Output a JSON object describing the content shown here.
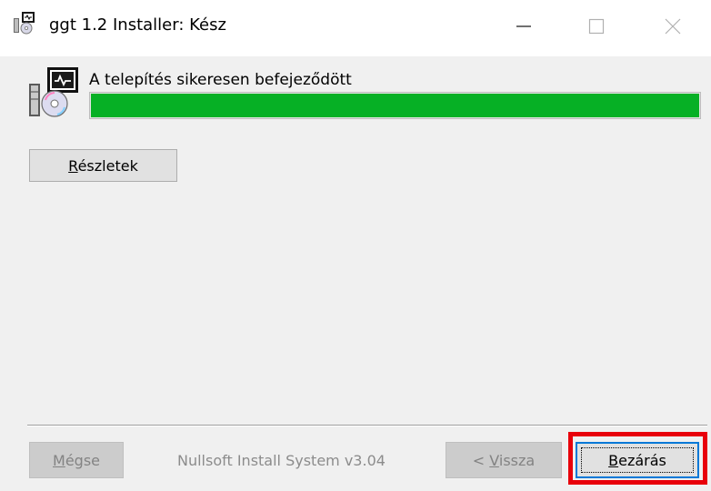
{
  "window": {
    "title": "ggt 1.2 Installer: Kész",
    "icons": {
      "app": "installer-icon",
      "minimize": "minimize-icon",
      "maximize": "maximize-icon",
      "close": "close-icon"
    }
  },
  "status": {
    "text": "A telepítés sikeresen befejeződött",
    "icon": "installer-cd-icon",
    "progress_percent": 100,
    "progress_color": "#06b025"
  },
  "details_button": {
    "prefix": "",
    "mnemonic": "R",
    "rest": "észletek"
  },
  "footer": {
    "cancel": {
      "prefix": "",
      "mnemonic": "M",
      "rest": "égse",
      "enabled": false
    },
    "brand": "Nullsoft Install System v3.04",
    "back": {
      "prefix": "< ",
      "mnemonic": "V",
      "rest": "issza",
      "enabled": false
    },
    "close": {
      "prefix": "",
      "mnemonic": "B",
      "rest": "ezárás",
      "enabled": true
    }
  },
  "highlight_color": "#e8000b"
}
